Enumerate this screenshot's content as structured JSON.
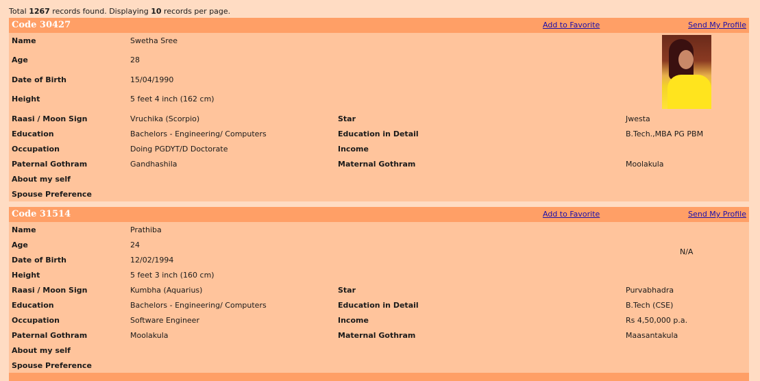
{
  "summary": {
    "prefix": "Total ",
    "total": "1267",
    "middle": " records found. Displaying ",
    "per_page": "10",
    "suffix": " records per page."
  },
  "actions": {
    "favorite": "Add to Favorite",
    "send": "Send My Profile"
  },
  "records": [
    {
      "code": "Code 30427",
      "name_label": "Name",
      "name": "Swetha Sree",
      "age_label": "Age",
      "age": "28",
      "dob_label": "Date of Birth",
      "dob": "15/04/1990",
      "height_label": "Height",
      "height": "5 feet 4 inch (162 cm)",
      "raasi_label": "Raasi / Moon Sign",
      "raasi": "Vruchika (Scorpio)",
      "star_label": "Star",
      "star": "Jwesta",
      "edu_label": "Education",
      "edu": "Bachelors - Engineering/ Computers",
      "edu_detail_label": "Education in Detail",
      "edu_detail": "B.Tech.,MBA PG PBM",
      "occ_label": "Occupation",
      "occ": "Doing PGDYT/D Doctorate",
      "income_label": "Income",
      "income": "",
      "pgoth_label": "Paternal Gothram",
      "pgoth": "Gandhashila",
      "mgoth_label": "Maternal Gothram",
      "mgoth": "Moolakula",
      "about_label": "About my self",
      "spouse_label": "Spouse Preference"
    },
    {
      "code": "Code 31514",
      "name_label": "Name",
      "name": "Prathiba",
      "age_label": "Age",
      "age": "24",
      "dob_label": "Date of Birth",
      "dob": "12/02/1994",
      "height_label": "Height",
      "height": "5 feet 3 inch (160 cm)",
      "raasi_label": "Raasi / Moon Sign",
      "raasi": "Kumbha (Aquarius)",
      "star_label": "Star",
      "star": "Purvabhadra",
      "edu_label": "Education",
      "edu": "Bachelors - Engineering/ Computers",
      "edu_detail_label": "Education in Detail",
      "edu_detail": "B.Tech (CSE)",
      "occ_label": "Occupation",
      "occ": "Software Engineer",
      "income_label": "Income",
      "income": "Rs 4,50,000 p.a.",
      "pgoth_label": "Paternal Gothram",
      "pgoth": "Moolakula",
      "mgoth_label": "Maternal Gothram",
      "mgoth": "Maasantakula",
      "about_label": "About my self",
      "spouse_label": "Spouse Preference",
      "photo_na": "N/A"
    }
  ]
}
